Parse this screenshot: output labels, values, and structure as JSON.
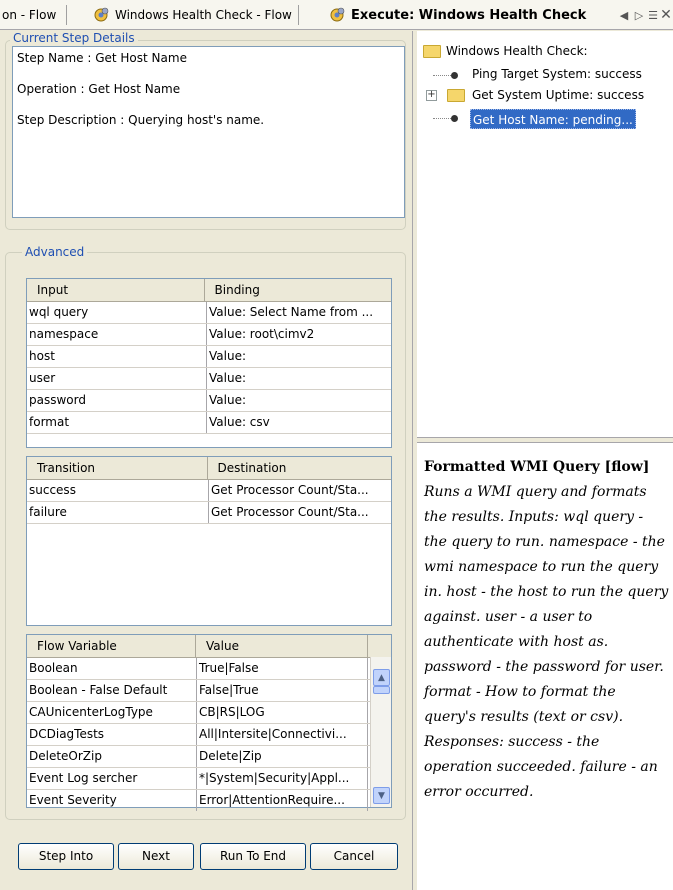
{
  "tabs": [
    {
      "label": "on - Flow"
    },
    {
      "label": "Windows Health Check - Flow"
    },
    {
      "label": "Execute: Windows Health Check"
    }
  ],
  "details": {
    "legend": "Current Step Details",
    "step_name": "Step Name : Get Host Name",
    "operation": "Operation : Get Host Name",
    "description": "Step Description : Querying host's name."
  },
  "advanced": {
    "legend": "Advanced",
    "inputs": {
      "headers": [
        "Input",
        "Binding"
      ],
      "rows": [
        [
          "wql query",
          "Value: Select Name from ..."
        ],
        [
          "namespace",
          "Value: root\\cimv2"
        ],
        [
          "host",
          "Value:"
        ],
        [
          "user",
          "Value:"
        ],
        [
          "password",
          "Value:"
        ],
        [
          "format",
          "Value: csv"
        ]
      ]
    },
    "transitions": {
      "headers": [
        "Transition",
        "Destination"
      ],
      "rows": [
        [
          "success",
          "Get Processor Count/Sta..."
        ],
        [
          "failure",
          "Get Processor Count/Sta..."
        ]
      ]
    },
    "variables": {
      "headers": [
        "Flow Variable",
        "Value"
      ],
      "rows": [
        [
          "Boolean",
          "True|False"
        ],
        [
          "Boolean - False Default",
          "False|True"
        ],
        [
          "CAUnicenterLogType",
          "CB|RS|LOG"
        ],
        [
          "DCDiagTests",
          "All|Intersite|Connectivi..."
        ],
        [
          "DeleteOrZip",
          "Delete|Zip"
        ],
        [
          "Event Log sercher",
          "*|System|Security|Appl..."
        ],
        [
          "Event Severity",
          "Error|AttentionRequire..."
        ]
      ]
    }
  },
  "buttons": {
    "step_into": "Step Into",
    "next": "Next",
    "run_to_end": "Run To End",
    "cancel": "Cancel"
  },
  "tree": {
    "root": "Windows Health Check:",
    "items": [
      {
        "label": "Ping Target System: success"
      },
      {
        "label": "Get System Uptime: success"
      },
      {
        "label": "Get Host Name: pending..."
      }
    ]
  },
  "description": {
    "title": "Formatted WMI Query [flow]",
    "body": "Runs a WMI query and formats the results. Inputs: wql query - the query to run. namespace - the wmi namespace to run the query in. host - the host to run the query against. user - a user to authenticate with host as. password - the password for user. format - How to format the query's results (text or csv). Responses: success - the operation succeeded. failure - an error occurred."
  },
  "colors": {
    "legend": "#1f4fb2",
    "selection": "#316ac5",
    "panel": "#ece9d8"
  },
  "icons": [
    "gear-icon",
    "folder-icon",
    "tree-expand-icon",
    "scroll-up-icon",
    "scroll-down-icon",
    "tab-prev-icon",
    "tab-next-icon",
    "tab-list-icon",
    "close-icon"
  ]
}
